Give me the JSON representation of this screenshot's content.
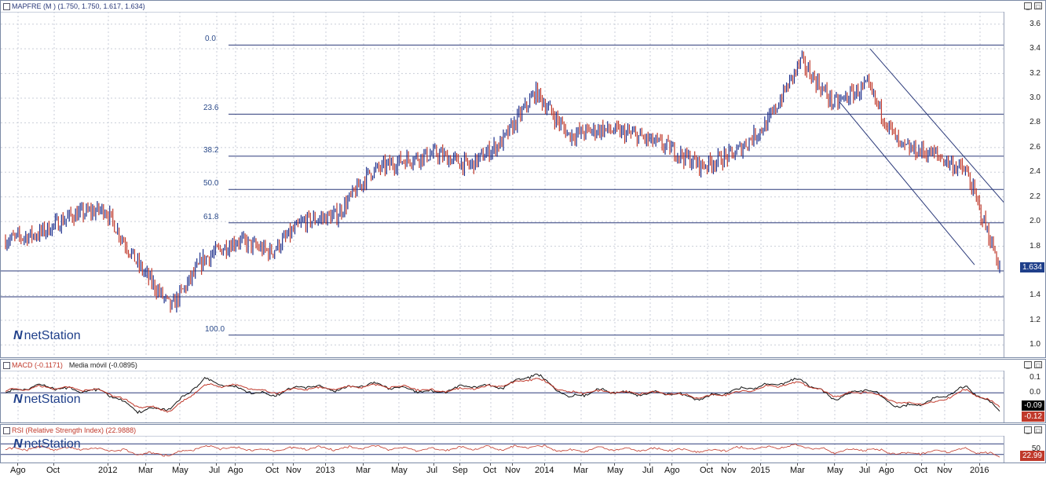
{
  "price_panel": {
    "header": "MAPFRE (M ) (1.750, 1.750, 1.617, 1.634)",
    "last_value": "1.634",
    "y_ticks": [
      "3.6",
      "3.4",
      "3.2",
      "3.0",
      "2.8",
      "2.6",
      "2.4",
      "2.2",
      "2.0",
      "1.8",
      "1.6",
      "1.4",
      "1.2",
      "1.0"
    ],
    "fib_labels": [
      "0.0",
      "23.6",
      "38.2",
      "50.0",
      "61.8",
      "100.0"
    ],
    "logo_text": "netStation"
  },
  "macd_panel": {
    "header": "MACD (-0.1171)",
    "ma_label": "Media móvil (-0.0895)",
    "y_ticks": [
      "0.1",
      "0.0"
    ],
    "value_macd": "-0.09",
    "value_signal": "-0.12",
    "logo_text": "netStation"
  },
  "rsi_panel": {
    "header": "RSI (Relative Strength Index) (22.9888)",
    "y_ticks": [
      "50"
    ],
    "value": "22.99",
    "logo_text": "netStation"
  },
  "x_labels": [
    "Ago",
    "Oct",
    "2012",
    "Mar",
    "May",
    "Jul",
    "Ago",
    "Oct",
    "Nov",
    "2013",
    "Mar",
    "May",
    "Jul",
    "Sep",
    "Oct",
    "Nov",
    "2014",
    "Mar",
    "May",
    "Jul",
    "Ago",
    "Oct",
    "Nov",
    "2015",
    "Mar",
    "May",
    "Jul",
    "Ago",
    "Oct",
    "Nov",
    "2016"
  ],
  "colors": {
    "up": "#1d2f8c",
    "down": "#c0392b",
    "grid": "#c9ced8",
    "fib": "#2b3a7a",
    "accent": "#1f3f8a"
  },
  "chart_data": {
    "type": "line",
    "title": "MAPFRE (M )",
    "ohlc_last": {
      "open": 1.75,
      "high": 1.75,
      "low": 1.617,
      "close": 1.634
    },
    "ylim": [
      0.9,
      3.7
    ],
    "fibonacci_levels": [
      {
        "label": "0.0",
        "price": 3.43
      },
      {
        "label": "23.6",
        "price": 2.87
      },
      {
        "label": "38.2",
        "price": 2.53
      },
      {
        "label": "50.0",
        "price": 2.26
      },
      {
        "label": "61.8",
        "price": 1.99
      },
      {
        "label": "100.0",
        "price": 1.08
      }
    ],
    "horizontal_lines": [
      1.6,
      1.39
    ],
    "x": [
      "2011-08",
      "2011-10",
      "2012-01",
      "2012-03",
      "2012-05",
      "2012-07",
      "2012-08",
      "2012-10",
      "2012-11",
      "2013-01",
      "2013-03",
      "2013-05",
      "2013-07",
      "2013-09",
      "2013-10",
      "2013-11",
      "2014-01",
      "2014-03",
      "2014-05",
      "2014-07",
      "2014-08",
      "2014-10",
      "2014-11",
      "2015-01",
      "2015-03",
      "2015-05",
      "2015-07",
      "2015-08",
      "2015-10",
      "2015-11",
      "2016-01"
    ],
    "series": [
      {
        "values": [
          1.85,
          1.9,
          2.05,
          2.1,
          1.65,
          1.3,
          1.7,
          1.85,
          1.75,
          2.0,
          2.05,
          2.4,
          2.5,
          2.55,
          2.45,
          2.65,
          3.05,
          2.7,
          2.75,
          2.7,
          2.6,
          2.45,
          2.55,
          2.8,
          3.3,
          2.95,
          3.1,
          2.6,
          2.55,
          2.4,
          1.634
        ]
      },
      {
        "name": "MACD",
        "values": [
          0.0,
          0.05,
          0.02,
          0.01,
          -0.12,
          -0.1,
          0.09,
          0.03,
          -0.02,
          0.05,
          0.02,
          0.06,
          0.03,
          0.0,
          0.05,
          0.04,
          0.13,
          -0.03,
          0.02,
          -0.01,
          0.0,
          -0.04,
          0.02,
          0.05,
          0.09,
          -0.04,
          0.03,
          -0.1,
          -0.05,
          0.04,
          -0.1171
        ]
      },
      {
        "name": "Media móvil",
        "values": [
          0.01,
          0.04,
          0.03,
          0.01,
          -0.09,
          -0.12,
          0.05,
          0.05,
          0.0,
          0.03,
          0.03,
          0.05,
          0.04,
          0.01,
          0.03,
          0.05,
          0.1,
          0.0,
          0.01,
          0.0,
          0.0,
          -0.03,
          0.0,
          0.04,
          0.07,
          -0.02,
          0.01,
          -0.07,
          -0.07,
          0.02,
          -0.0895
        ]
      },
      {
        "name": "RSI",
        "values": [
          48,
          55,
          52,
          50,
          35,
          30,
          60,
          52,
          45,
          55,
          52,
          58,
          52,
          48,
          55,
          52,
          62,
          42,
          52,
          48,
          50,
          42,
          52,
          56,
          62,
          40,
          52,
          32,
          40,
          50,
          22.9888
        ]
      }
    ],
    "macd_ylim": [
      -0.2,
      0.15
    ],
    "rsi_ylim": [
      0,
      100
    ]
  }
}
